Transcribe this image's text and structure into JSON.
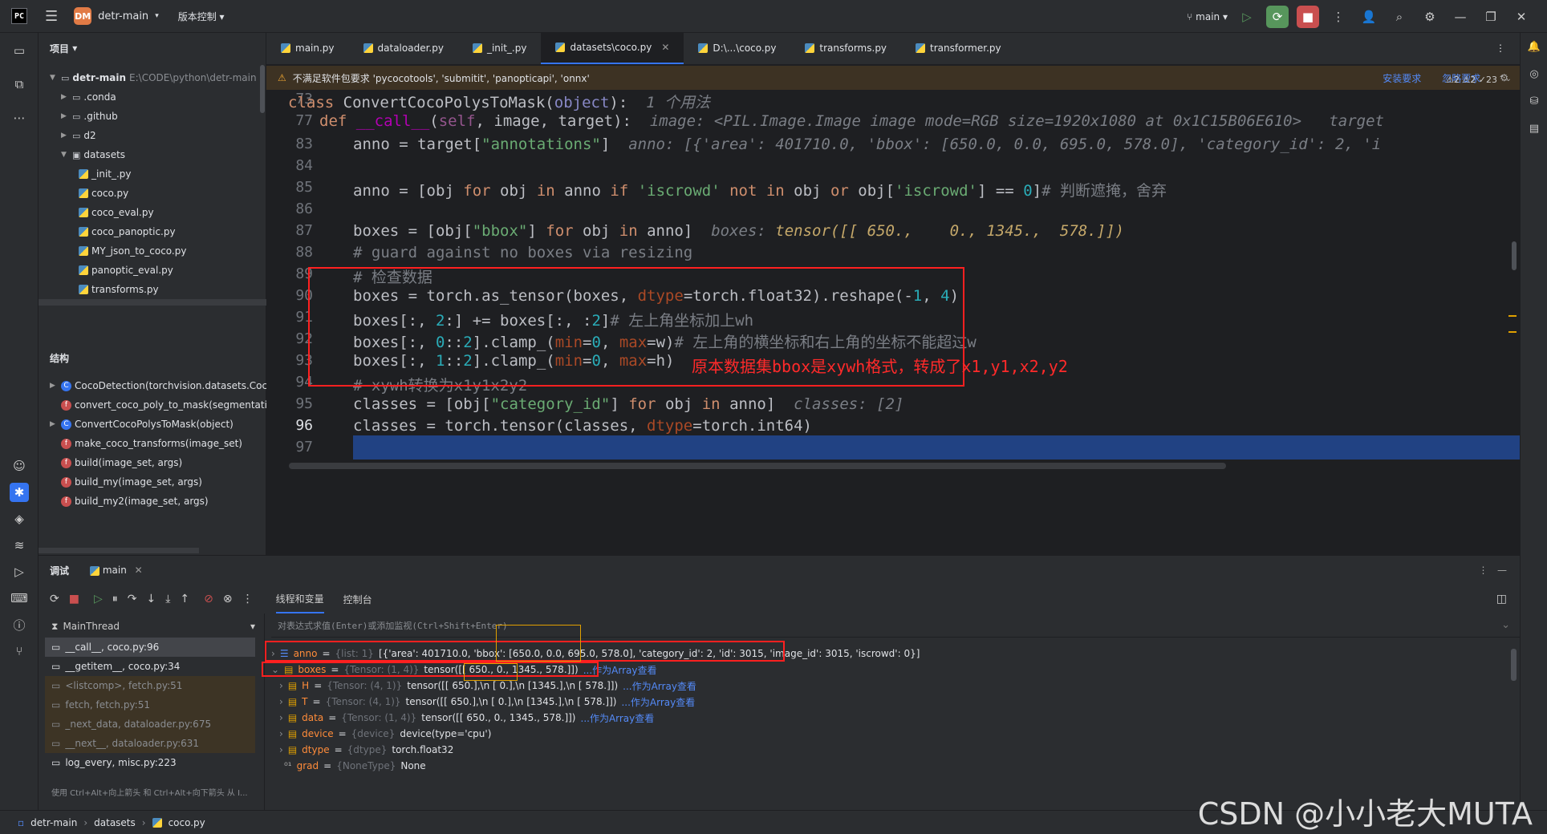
{
  "titlebar": {
    "project_badge": "DM",
    "project_name": "detr-main",
    "vcs_label": "版本控制",
    "branch": "main"
  },
  "project_panel": {
    "header": "项目",
    "root_name": "detr-main",
    "root_path": "E:\\CODE\\python\\detr-main",
    "items": [
      ".conda",
      ".github",
      "d2",
      "datasets",
      "_init_.py",
      "coco.py",
      "coco_eval.py",
      "coco_panoptic.py",
      "MY_json_to_coco.py",
      "panoptic_eval.py",
      "transforms.py"
    ]
  },
  "structure": {
    "header": "结构",
    "items": [
      "CocoDetection(torchvision.datasets.Coc",
      "convert_coco_poly_to_mask(segmentatic",
      "ConvertCocoPolysToMask(object)",
      "make_coco_transforms(image_set)",
      "build(image_set, args)",
      "build_my(image_set, args)",
      "build_my2(image_set, args)"
    ]
  },
  "tabs": [
    "main.py",
    "dataloader.py",
    "_init_.py",
    "datasets\\coco.py",
    "D:\\...\\coco.py",
    "transforms.py",
    "transformer.py"
  ],
  "warning": {
    "text": "不满足软件包要求 'pycocotools', 'submitit', 'panopticapi', 'onnx'",
    "install": "安装要求",
    "ignore": "忽略要求",
    "inspect": "⚠2 ⚠2 ✓23"
  },
  "code": {
    "l73": "73",
    "l77": "77",
    "l83": "83",
    "l84": "84",
    "l85": "85",
    "l86": "86",
    "l87": "87",
    "l88": "88",
    "l89": "89",
    "l90": "90",
    "l91": "91",
    "l92": "92",
    "l93": "93",
    "l94": "94",
    "l95": "95",
    "l96": "96",
    "l97": "97",
    "usages": "1 个用法",
    "hint77": "image: <PIL.Image.Image image mode=RGB size=1920x1080 at 0x1C15B06E610>   target",
    "hint83": "anno: [{'area': 401710.0, 'bbox': [650.0, 0.0, 695.0, 578.0], 'category_id': 2, 'i",
    "hint87a": "boxes: ",
    "hint87b": "tensor([[ 650.,    0., 1345.,  578.]])",
    "hint95": "classes: [2]",
    "c85": "# 判断遮掩，舍弃",
    "c88": "# guard against no boxes via resizing",
    "c89": "# 检查数据",
    "c91": "# 左上角坐标加上wh",
    "c92": "# 左上角的横坐标和右上角的坐标不能超过w",
    "c94": "# xywh转换为x1y1x2y2"
  },
  "annotation": "原本数据集bbox是xywh格式，转成了x1,y1,x2,y2",
  "debug": {
    "tab_debug": "调试",
    "tab_main": "main",
    "tab_threads": "线程和变量",
    "tab_console": "控制台",
    "thread": "MainThread",
    "eval_placeholder": "对表达式求值(Enter)或添加监视(Ctrl+Shift+Enter)",
    "frames": [
      "__call__, coco.py:96",
      "__getitem__, coco.py:34",
      "<listcomp>, fetch.py:51",
      "fetch, fetch.py:51",
      "_next_data, dataloader.py:675",
      "__next__, dataloader.py:631",
      "log_every, misc.py:223"
    ],
    "frames_hint": "使用 Ctrl+Alt+向上箭头 和 Ctrl+Alt+向下箭头 从 I...",
    "vars": [
      {
        "name": "anno",
        "type": "{list: 1}",
        "value": "[{'area': 401710.0, 'bbox': [650.0, 0.0, 695.0, 578.0], 'category_id': 2, 'id': 3015, 'image_id': 3015, 'iscrowd': 0}]",
        "link": ""
      },
      {
        "name": "boxes",
        "type": "{Tensor: (1, 4)}",
        "value": "tensor([[ 650.,    0., 1345.,  578.]])",
        "link": "...作为Array查看"
      },
      {
        "name": "H",
        "type": "{Tensor: (4, 1)}",
        "value": "tensor([[ 650.],\\n      [   0.],\\n      [1345.],\\n      [ 578.]])",
        "link": "...作为Array查看"
      },
      {
        "name": "T",
        "type": "{Tensor: (4, 1)}",
        "value": "tensor([[ 650.],\\n      [   0.],\\n      [1345.],\\n      [ 578.]])",
        "link": "...作为Array查看"
      },
      {
        "name": "data",
        "type": "{Tensor: (1, 4)}",
        "value": "tensor([[ 650.,    0., 1345.,  578.]])",
        "link": "...作为Array查看"
      },
      {
        "name": "device",
        "type": "{device}",
        "value": "device(type='cpu')",
        "link": ""
      },
      {
        "name": "dtype",
        "type": "{dtype}",
        "value": "torch.float32",
        "link": ""
      },
      {
        "name": "grad",
        "type": "{NoneType}",
        "value": "None",
        "link": ""
      }
    ]
  },
  "status": {
    "root": "detr-main",
    "folder": "datasets",
    "file": "coco.py"
  },
  "watermark": "CSDN @小小老大MUTA"
}
